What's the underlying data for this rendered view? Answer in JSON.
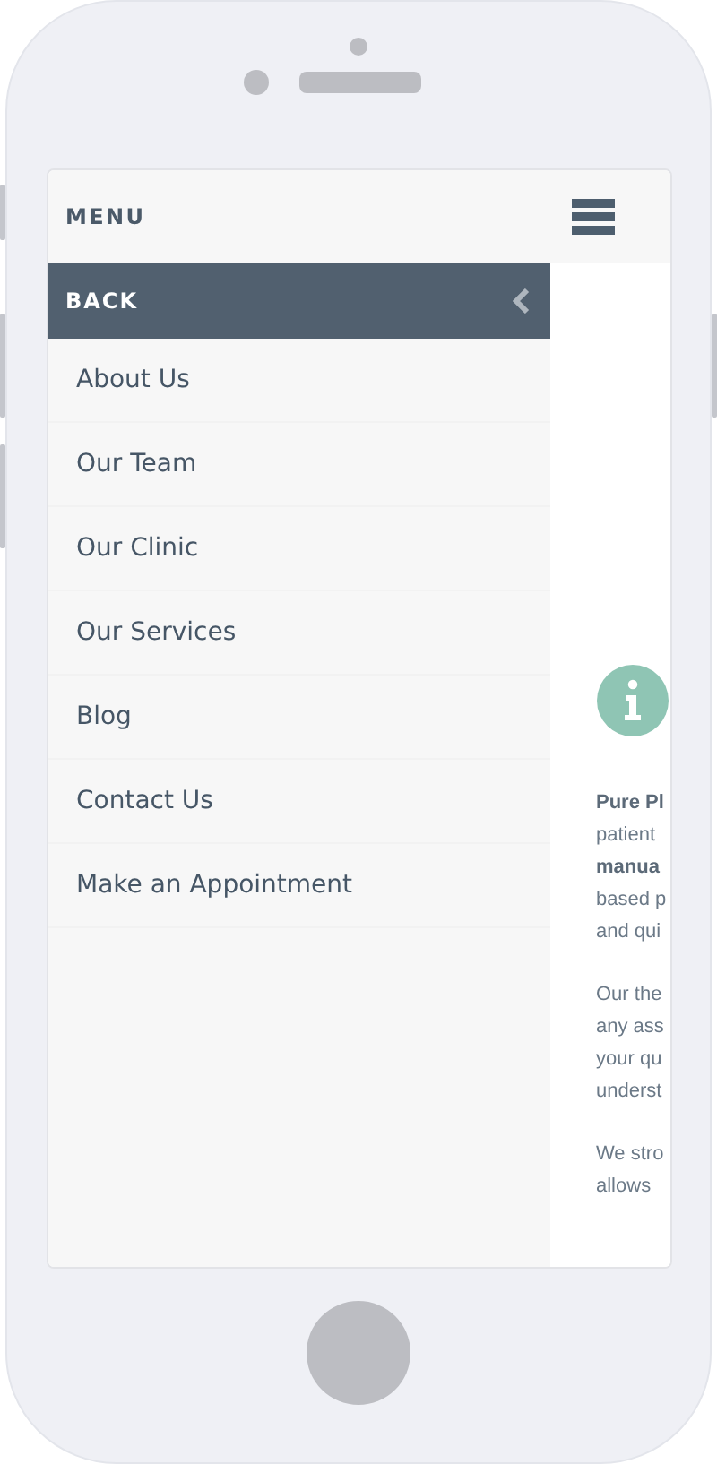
{
  "header": {
    "title": "MENU"
  },
  "back": {
    "label": "BACK"
  },
  "menu_items": [
    {
      "label": "About Us"
    },
    {
      "label": "Our Team"
    },
    {
      "label": "Our Clinic"
    },
    {
      "label": "Our Services"
    },
    {
      "label": "Blog"
    },
    {
      "label": "Contact Us"
    },
    {
      "label": "Make an Appointment"
    }
  ],
  "content": {
    "paragraphs": [
      {
        "lines": [
          {
            "text": "Pure Pl",
            "bold": true
          },
          {
            "text": "patient",
            "bold": false
          },
          {
            "text": "manua",
            "bold": true
          },
          {
            "text": "based p",
            "bold": false
          },
          {
            "text": "and qui",
            "bold": false
          }
        ]
      },
      {
        "lines": [
          {
            "text": "Our the",
            "bold": false
          },
          {
            "text": "any ass",
            "bold": false
          },
          {
            "text": "your qu",
            "bold": false
          },
          {
            "text": "underst",
            "bold": false
          }
        ]
      },
      {
        "lines": [
          {
            "text": "We stro",
            "bold": false
          },
          {
            "text": "allows",
            "bold": false
          }
        ]
      }
    ]
  }
}
